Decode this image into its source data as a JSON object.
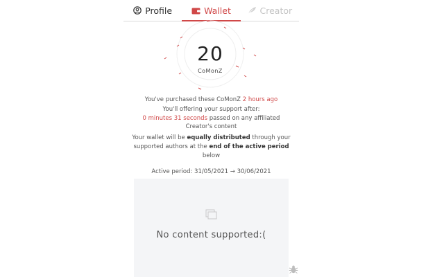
{
  "tabs": [
    {
      "label": "Profile",
      "icon": "user-circle-icon"
    },
    {
      "label": "Wallet",
      "icon": "wallet-icon",
      "active": true
    },
    {
      "label": "Creator",
      "icon": "feather-icon",
      "disabled": true
    }
  ],
  "wallet": {
    "amount": "20",
    "currency": "CoMonZ"
  },
  "info": {
    "purchased_prefix": "You've purchased these CoMonZ ",
    "purchased_time": "2 hours ago",
    "support_line": "You'll offering your support after:",
    "support_time": "0 minutes 31 seconds",
    "support_suffix": " passed on any affiliated",
    "support_suffix2": "Creator's content",
    "dist_prefix": "Your wallet will be ",
    "dist_bold": "equally distributed",
    "dist_mid": " through your supported authors at the ",
    "dist_bold2": "end of the active period",
    "dist_suffix": " below",
    "active_period": "Active period: 31/05/2021 → 30/06/2021"
  },
  "panel": {
    "empty_text": "No content supported:("
  },
  "colors": {
    "accent": "#d04848",
    "panel_bg": "#f4f5f7"
  }
}
